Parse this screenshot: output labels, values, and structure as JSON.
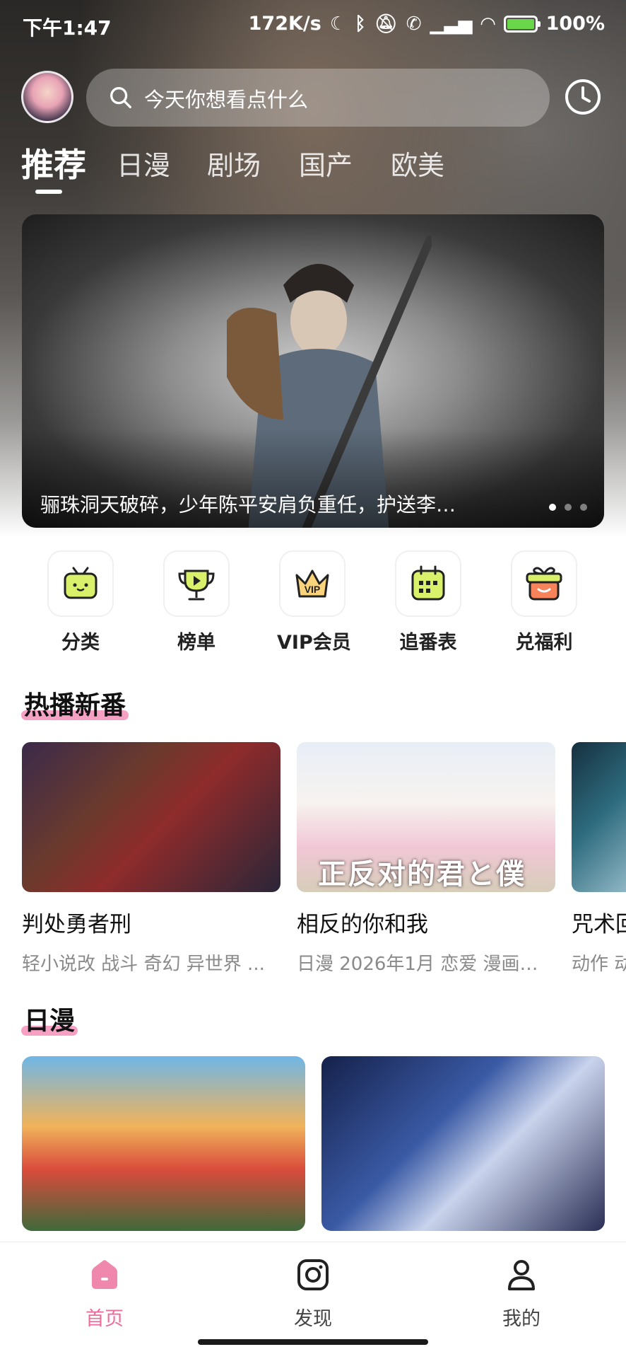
{
  "status_bar": {
    "time": "下午1:47",
    "speed": "172K/s",
    "battery": "100%"
  },
  "header": {
    "search_placeholder": "今天你想看点什么"
  },
  "tabs": [
    {
      "label": "推荐",
      "active": true
    },
    {
      "label": "日漫",
      "active": false
    },
    {
      "label": "剧场",
      "active": false
    },
    {
      "label": "国产",
      "active": false
    },
    {
      "label": "欧美",
      "active": false
    }
  ],
  "banner": {
    "caption": "骊珠洞天破碎，少年陈平安肩负重任，护送李…",
    "page_count": 3,
    "current_page": 1
  },
  "quick_entries": [
    {
      "label": "分类",
      "icon": "tv-icon"
    },
    {
      "label": "榜单",
      "icon": "trophy-play-icon"
    },
    {
      "label": "VIP会员",
      "icon": "vip-crown-icon"
    },
    {
      "label": "追番表",
      "icon": "calendar-icon"
    },
    {
      "label": "兑福利",
      "icon": "gift-icon"
    }
  ],
  "sections": {
    "hot": {
      "title": "热播新番",
      "items": [
        {
          "title": "判处勇者刑",
          "tags": "轻小说改 战斗 奇幻 异世界 ..."
        },
        {
          "title": "相反的你和我",
          "tags": "日漫 2026年1月 恋爱 漫画…",
          "overlay": "正反对的君と僕"
        },
        {
          "title": "咒术回",
          "tags": "动作 动"
        }
      ]
    },
    "japanese": {
      "title": "日漫"
    }
  },
  "bottom_nav": [
    {
      "label": "首页",
      "icon": "home-icon",
      "active": true
    },
    {
      "label": "发现",
      "icon": "camera-icon",
      "active": false
    },
    {
      "label": "我的",
      "icon": "person-icon",
      "active": false
    }
  ],
  "colors": {
    "accent": "#ee6b9a",
    "section_highlight": "#f6a1c4"
  }
}
